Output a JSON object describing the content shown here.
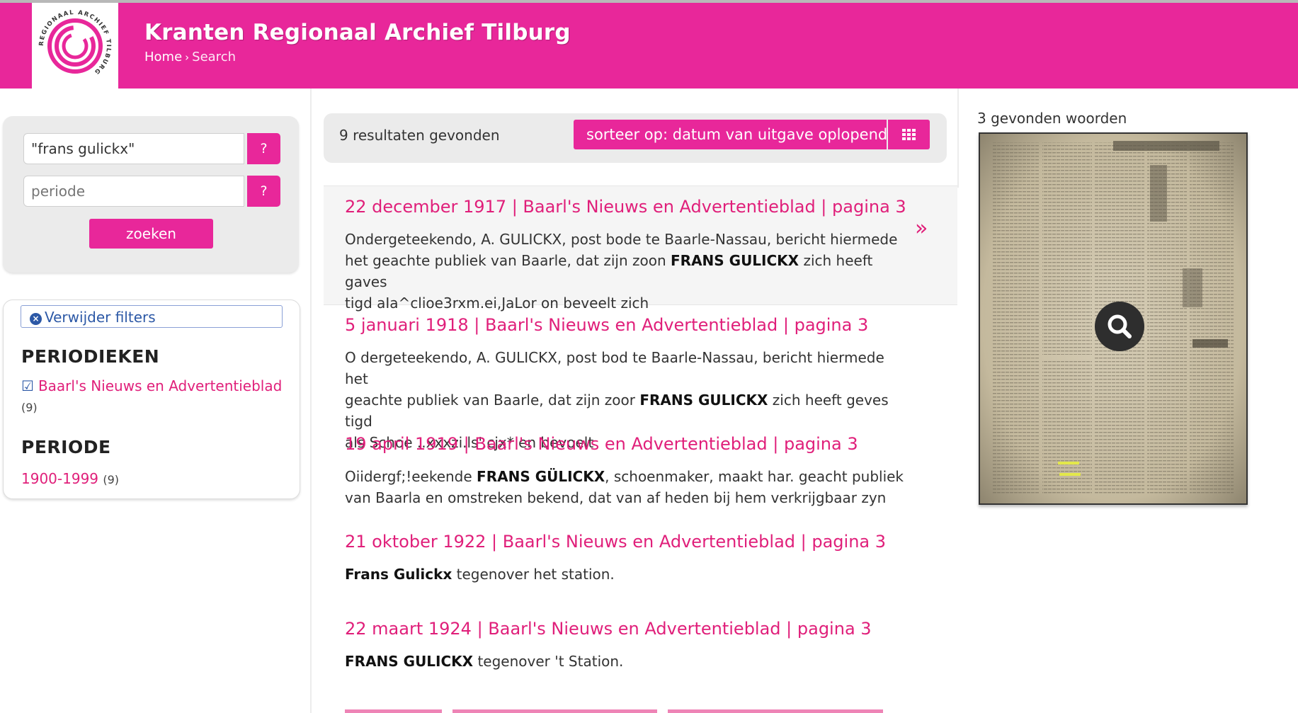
{
  "header": {
    "logo_text": "REGIONAAL ARCHIEF TILBURG",
    "title": "Kranten Regionaal Archief Tilburg",
    "breadcrumb": [
      "Home",
      "Search"
    ]
  },
  "search": {
    "query_value": "\"frans gulickx\"",
    "periode_placeholder": "periode",
    "help_label": "?",
    "submit_label": "zoeken"
  },
  "filters": {
    "remove_label": "Verwijder filters",
    "periodieken_heading": "PERIODIEKEN",
    "periodieken_item": "Baarl's Nieuws en Advertentieblad",
    "periodieken_count": "(9)",
    "periode_heading": "PERIODE",
    "periode_item": "1900-1999",
    "periode_count": "(9)"
  },
  "results_bar": {
    "count_text": "9 resultaten gevonden",
    "sort_label": "sorteer op: datum van uitgave oplopend"
  },
  "results": [
    {
      "title": "22 december 1917 | Baarl's Nieuws en Advertentieblad | pagina 3",
      "line1": "Ondergeteekendo, A. GULICKX, post bode te Baarle-Nassau, bericht hiermede",
      "line2a": "het geachte publiek van Baarle, dat zijn zoon ",
      "line2b": "FRANS GULICKX",
      "line2c": " zich heeft gaves",
      "line3": "tigd aIa^clioe3rxm.ei,JaLor on beveelt zich",
      "arrow": "»"
    },
    {
      "title": "5 januari 1918 | Baarl's Nieuws en Advertentieblad | pagina 3",
      "line1": "O dergeteekendo, A. GULICKX, post bod te Baarle-Nassau, bericht hiermede het",
      "line2a": "geachte publiek van Baarle, dat zijn zoor ",
      "line2b": "FRANS GULICKX",
      "line2c": " zich heeft geves tigd",
      "line3": "als Schoe ..xxxzi.ls'.cjx* en bevoelt"
    },
    {
      "title": "19 april 1919 | Baarl's Nieuws en Advertentieblad | pagina 3",
      "line1a": "Oiidergf;!eekende ",
      "line1b": "FRANS GÜLICKX",
      "line1c": ", schoenmaker, maakt har. geacht publiek",
      "line2": "van Baarla en omstreken bekend, dat van af heden bij hem verkrijgbaar zyn"
    },
    {
      "title": "21 oktober 1922 | Baarl's Nieuws en Advertentieblad | pagina 3",
      "bold": "Frans Gulickx",
      "rest": " tegenover het station."
    },
    {
      "title": "22 maart 1924 | Baarl's Nieuws en Advertentieblad | pagina 3",
      "bold": "FRANS GULICKX",
      "rest": " tegenover 't Station."
    }
  ],
  "preview": {
    "found_words": "3 gevonden woorden"
  },
  "colors": {
    "brand_pink": "#e8279a",
    "link_pink": "#e01f7a",
    "filter_blue": "#2c58a6"
  }
}
